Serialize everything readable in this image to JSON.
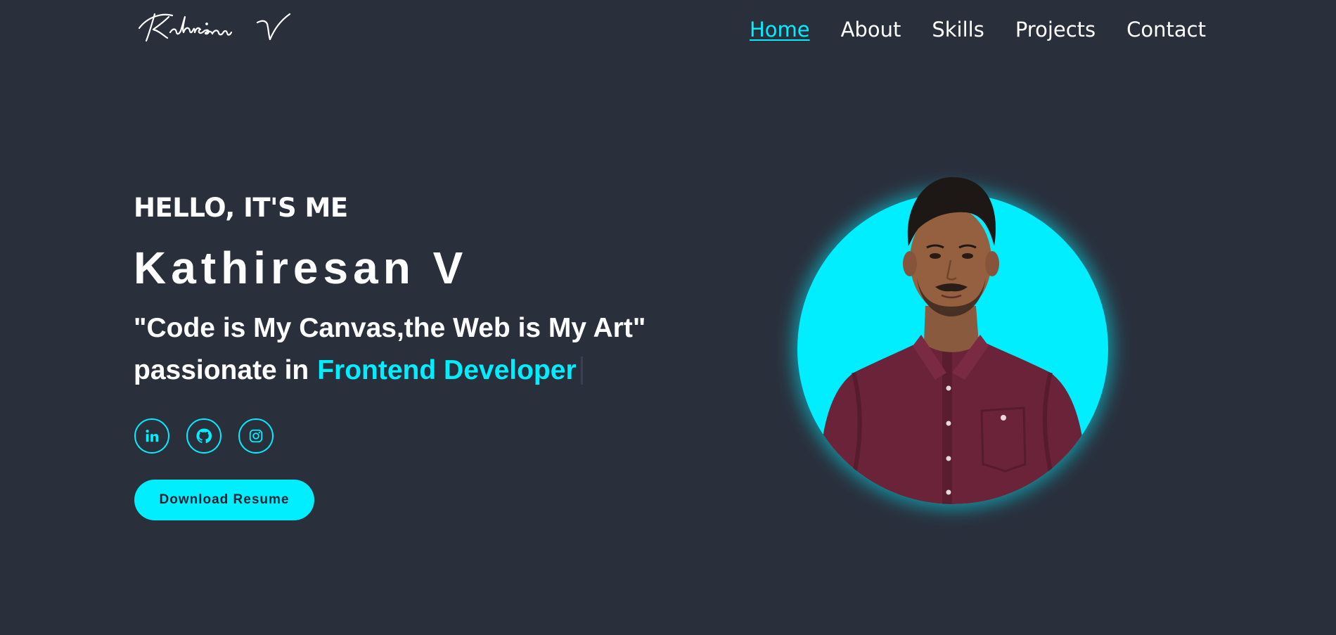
{
  "header": {
    "logo_text": "Kathiresan V",
    "nav": [
      {
        "label": "Home",
        "active": true
      },
      {
        "label": "About",
        "active": false
      },
      {
        "label": "Skills",
        "active": false
      },
      {
        "label": "Projects",
        "active": false
      },
      {
        "label": "Contact",
        "active": false
      }
    ]
  },
  "hero": {
    "greeting": "HELLO, IT'S ME",
    "name": "Kathiresan V",
    "quote": "\"Code is My Canvas,the Web is My Art\"",
    "passion_prefix": "passionate in",
    "passion_role": "Frontend Developer"
  },
  "socials": [
    {
      "icon": "linkedin-icon"
    },
    {
      "icon": "github-icon"
    },
    {
      "icon": "instagram-icon"
    }
  ],
  "resume_button": {
    "label": "Download Resume"
  },
  "colors": {
    "background": "#2a2f3c",
    "accent": "#00eeff",
    "text": "#ffffff"
  }
}
